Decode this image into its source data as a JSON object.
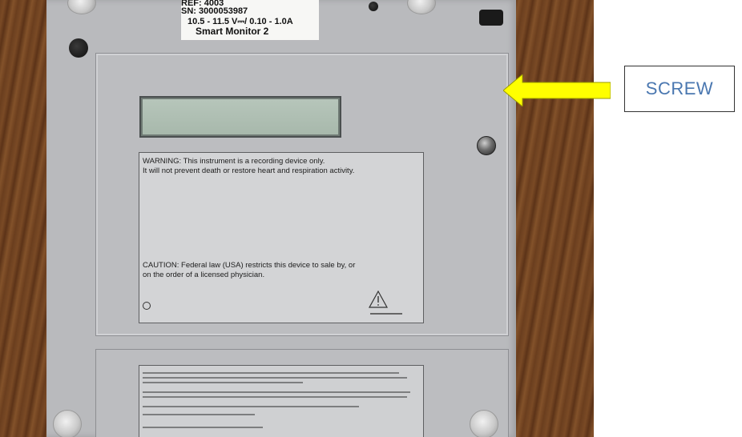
{
  "photo": {
    "sticker": {
      "ref": "REF: 4003",
      "sn": "SN: 3000053987",
      "rating": "10.5 - 11.5 V⎓/ 0.10 - 1.0A",
      "model": "Smart Monitor 2"
    },
    "warning_card": {
      "warning_line1": "WARNING:  This instrument is a recording device only.",
      "warning_line2": "It will not prevent death or restore heart and respiration activity.",
      "caution_line1": "CAUTION:  Federal law (USA) restricts this device to sale by, or",
      "caution_line2": "on the order of a licensed physician."
    }
  },
  "callout": {
    "label": "SCREW",
    "label_color": "#4a77b0",
    "arrow_color": "#ffff00",
    "arrow_icon": "left-arrow-icon"
  }
}
